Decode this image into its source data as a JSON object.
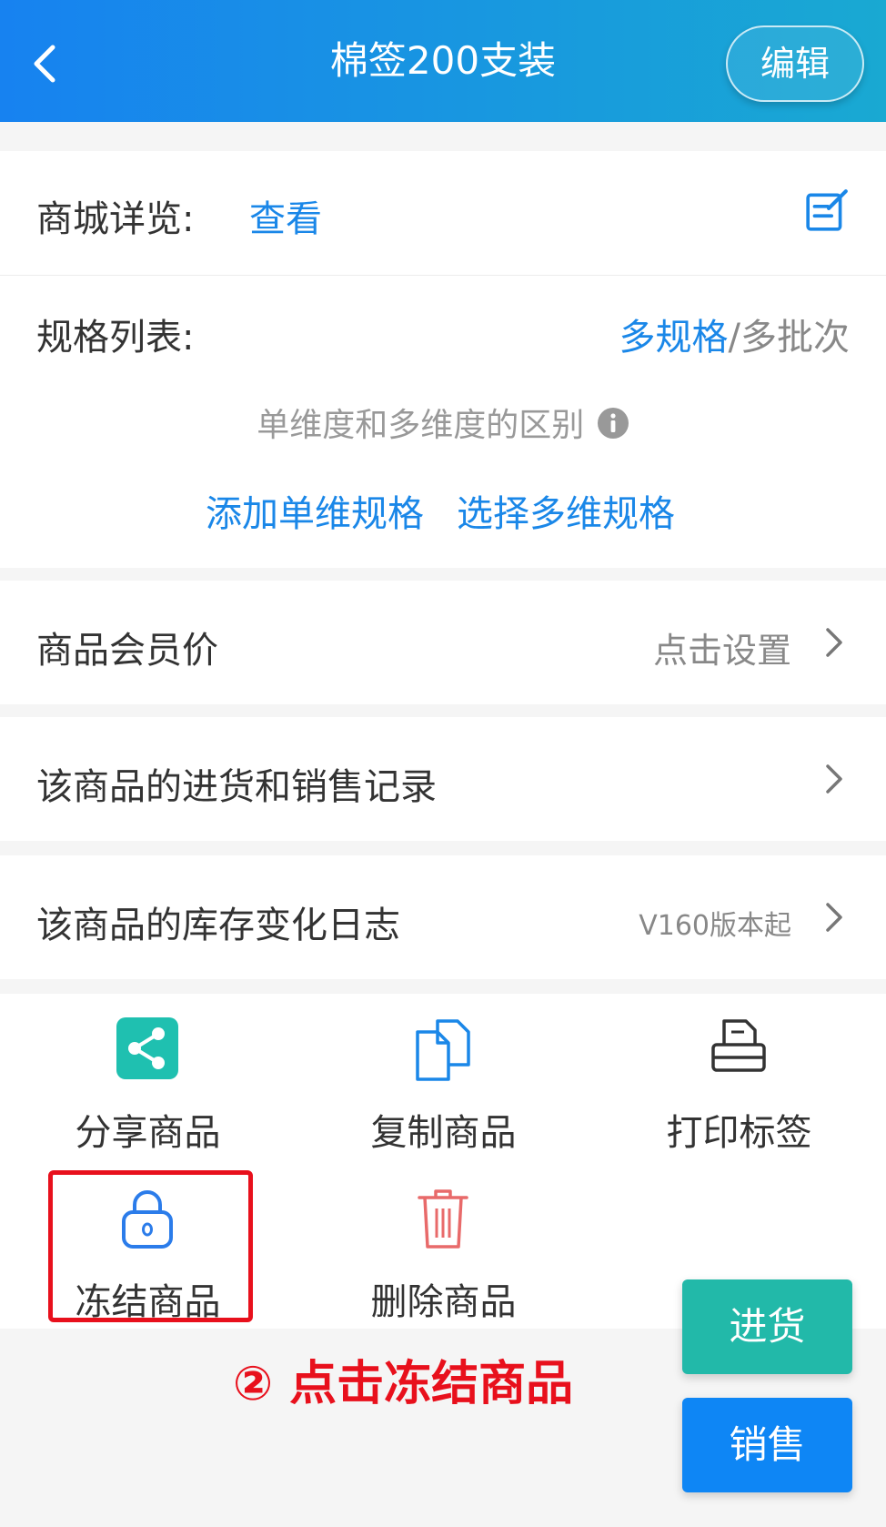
{
  "header": {
    "title": "棉签200支装",
    "edit_label": "编辑"
  },
  "mall_preview": {
    "label": "商城详览:",
    "link": "查看"
  },
  "spec_list": {
    "label": "规格列表:",
    "mode_active": "多规格",
    "separator": "/",
    "mode_inactive": "多批次",
    "hint": "单维度和多维度的区别",
    "add_single": "添加单维规格",
    "choose_multi": "选择多维规格"
  },
  "rows": {
    "member_price": {
      "label": "商品会员价",
      "value": "点击设置"
    },
    "purchase_sales": {
      "label": "该商品的进货和销售记录"
    },
    "stock_log": {
      "label": "该商品的库存变化日志",
      "value": "V160版本起"
    }
  },
  "actions": {
    "share": "分享商品",
    "copy": "复制商品",
    "print": "打印标签",
    "freeze": "冻结商品",
    "delete": "删除商品"
  },
  "annotation": "② 点击冻结商品",
  "floating": {
    "purchase": "进货",
    "sale": "销售"
  },
  "colors": {
    "header_start": "#1782f0",
    "header_end": "#19a9d2",
    "link_blue": "#1a87e8",
    "share_green": "#1fc0b0",
    "delete_red": "#e86a6a",
    "annotation_red": "#e8101c",
    "purchase_teal": "#22b9a9",
    "sale_blue": "#0e86f5"
  }
}
